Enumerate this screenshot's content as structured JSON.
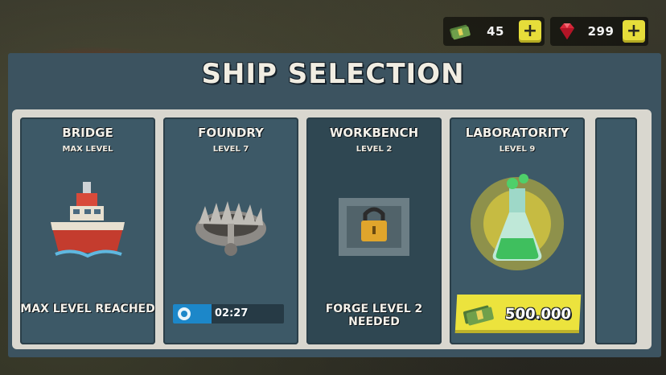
{
  "title": "SHIP SELECTION",
  "currency": {
    "cash": {
      "icon": "cash-stack-icon",
      "value": "45"
    },
    "gems": {
      "icon": "ruby-gem-icon",
      "value": "299"
    },
    "plus_label": "+"
  },
  "cards": [
    {
      "name": "BRIDGE",
      "level": "MAX LEVEL",
      "footer": "MAX LEVEL REACHED",
      "icon": "ship-icon"
    },
    {
      "name": "FOUNDRY",
      "level": "LEVEL 7",
      "timer": "02:27",
      "progress": 0.35,
      "icon": "bear-trap-icon"
    },
    {
      "name": "WORKBENCH",
      "level": "LEVEL 2",
      "footer": "FORGE LEVEL 2 NEEDED",
      "icon": "locked-crate-icon"
    },
    {
      "name": "LABORATORITY",
      "level": "LEVEL 9",
      "price": "500.000",
      "icon": "potion-flask-icon"
    }
  ],
  "colors": {
    "accent_yellow": "#ece33d",
    "panel": "#3d5967",
    "timer_blue": "#1c87c9"
  }
}
